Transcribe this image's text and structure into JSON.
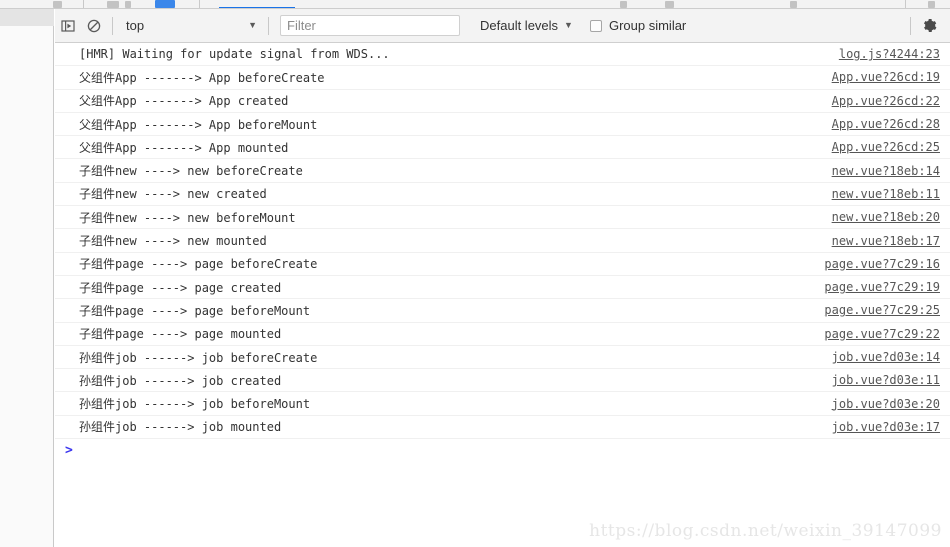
{
  "window": {
    "active_tab_accent": "#1a73e8",
    "toolbar_bg": "#f3f3f3",
    "panel_bg": "#ffffff"
  },
  "toolbar": {
    "sidebar_toggle_icon": "sidebar-toggle-icon",
    "clear_console_icon": "clear-console-icon",
    "context_selected": "top",
    "context_caret": "▼",
    "filter_placeholder": "Filter",
    "filter_value": "",
    "levels_label": "Default levels",
    "levels_caret": "▼",
    "group_similar_label": "Group similar",
    "group_similar_checked": false,
    "settings_icon": "gear-icon"
  },
  "console": {
    "prompt_caret": ">",
    "prompt_value": "",
    "rows": [
      {
        "message": "[HMR] Waiting for update signal from WDS...",
        "source": "log.js?4244:23"
      },
      {
        "message": "父组件App -------> App beforeCreate",
        "source": "App.vue?26cd:19"
      },
      {
        "message": "父组件App -------> App created",
        "source": "App.vue?26cd:22"
      },
      {
        "message": "父组件App -------> App beforeMount",
        "source": "App.vue?26cd:28"
      },
      {
        "message": "父组件App -------> App mounted",
        "source": "App.vue?26cd:25"
      },
      {
        "message": "子组件new ----> new beforeCreate",
        "source": "new.vue?18eb:14"
      },
      {
        "message": "子组件new ----> new created",
        "source": "new.vue?18eb:11"
      },
      {
        "message": "子组件new ----> new beforeMount",
        "source": "new.vue?18eb:20"
      },
      {
        "message": "子组件new ----> new mounted",
        "source": "new.vue?18eb:17"
      },
      {
        "message": "子组件page ----> page beforeCreate",
        "source": "page.vue?7c29:16"
      },
      {
        "message": "子组件page ----> page created",
        "source": "page.vue?7c29:19"
      },
      {
        "message": "子组件page ----> page beforeMount",
        "source": "page.vue?7c29:25"
      },
      {
        "message": "子组件page ----> page mounted",
        "source": "page.vue?7c29:22"
      },
      {
        "message": "孙组件job ------> job beforeCreate",
        "source": "job.vue?d03e:14"
      },
      {
        "message": "孙组件job ------> job created",
        "source": "job.vue?d03e:11"
      },
      {
        "message": "孙组件job ------> job beforeMount",
        "source": "job.vue?d03e:20"
      },
      {
        "message": "孙组件job ------> job mounted",
        "source": "job.vue?d03e:17"
      }
    ]
  },
  "watermark": {
    "text": "https://blog.csdn.net/weixin_39147099"
  }
}
